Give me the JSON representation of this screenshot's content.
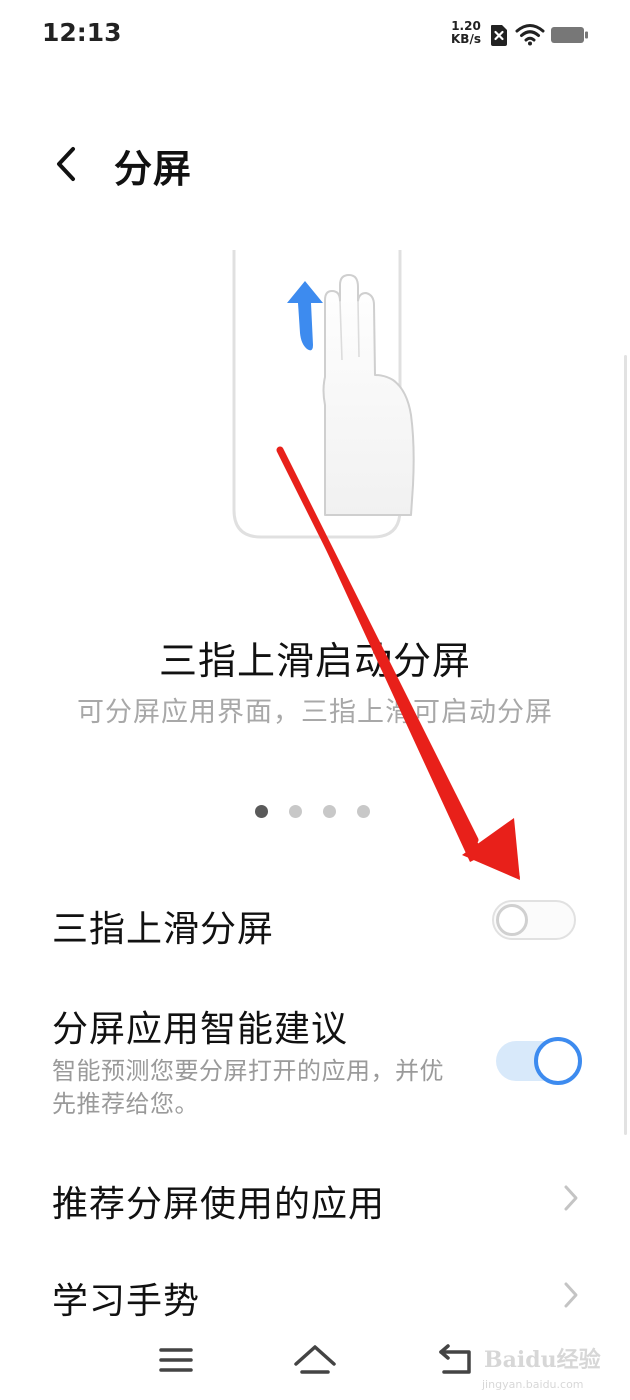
{
  "status_bar": {
    "time": "12:13",
    "net_speed_value": "1.20",
    "net_speed_unit": "KB/s",
    "icons": [
      "sim-x-icon",
      "wifi-icon",
      "battery-icon"
    ]
  },
  "header": {
    "back_icon": "back-arrow-icon",
    "title": "分屏"
  },
  "illustration": {
    "icons": [
      "phone-outline",
      "hand-gesture-icon",
      "arrow-up-icon"
    ],
    "accent_color": "#3d8bef"
  },
  "gesture_intro": {
    "title": "三指上滑启动分屏",
    "description": "可分屏应用界面，三指上滑可启动分屏",
    "page_count": 4,
    "active_page": 1
  },
  "settings": {
    "three_finger_split": {
      "title": "三指上滑分屏",
      "enabled": false
    },
    "smart_suggestion": {
      "title": "分屏应用智能建议",
      "subtitle": "智能预测您要分屏打开的应用，并优先推荐给您。",
      "enabled": true
    },
    "recommended_apps": {
      "title": "推荐分屏使用的应用"
    },
    "learn_gestures": {
      "title": "学习手势"
    }
  },
  "nav_bar": {
    "icons": [
      "menu-icon",
      "home-icon",
      "back-icon"
    ]
  },
  "watermark": {
    "text": "Baidu经验",
    "url": "jingyan.baidu.com"
  },
  "colors": {
    "accent": "#3d8bef",
    "annotation_arrow": "#e8201a",
    "toggle_on_track": "#d8e9fa"
  }
}
